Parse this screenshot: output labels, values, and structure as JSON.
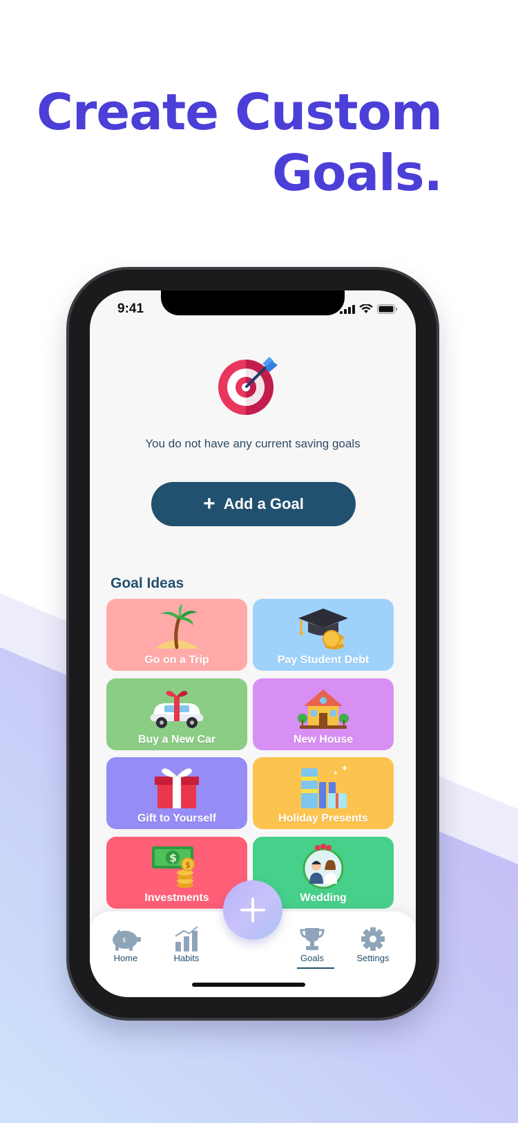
{
  "headline": {
    "line1": "Create Custom",
    "line2": "Goals."
  },
  "status_bar": {
    "time": "9:41"
  },
  "empty_state": {
    "message": "You do not have any current saving goals"
  },
  "add_goal": {
    "icon": "plus-icon",
    "label": "Add a Goal"
  },
  "goal_ideas": {
    "title": "Goal Ideas",
    "items": [
      {
        "label": "Go on a Trip",
        "color": "#ffaaa9",
        "icon": "palm-island-icon"
      },
      {
        "label": "Pay Student Debt",
        "color": "#9fd2fb",
        "icon": "graduation-cap-coins-icon"
      },
      {
        "label": "Buy a New Car",
        "color": "#8ccd86",
        "icon": "gift-car-icon"
      },
      {
        "label": "New House",
        "color": "#d88ff3",
        "icon": "house-icon"
      },
      {
        "label": "Gift to Yourself",
        "color": "#968cf5",
        "icon": "gift-box-icon"
      },
      {
        "label": "Holiday Presents",
        "color": "#fcc34e",
        "icon": "presents-icon"
      },
      {
        "label": "Investments",
        "color": "#ff5f77",
        "icon": "money-coins-icon"
      },
      {
        "label": "Wedding",
        "color": "#46d08a",
        "icon": "wedding-couple-icon"
      }
    ]
  },
  "tab_bar": {
    "tabs": [
      {
        "label": "Home",
        "icon": "piggy-bank-icon"
      },
      {
        "label": "Habits",
        "icon": "bar-chart-icon"
      },
      {
        "label": "Goals",
        "icon": "trophy-icon",
        "active": true
      },
      {
        "label": "Settings",
        "icon": "gear-icon"
      }
    ],
    "fab_icon": "plus-icon"
  },
  "colors": {
    "headline": "#4b3fd8",
    "primary": "#22506f",
    "icon_gray": "#8fa4b8"
  }
}
